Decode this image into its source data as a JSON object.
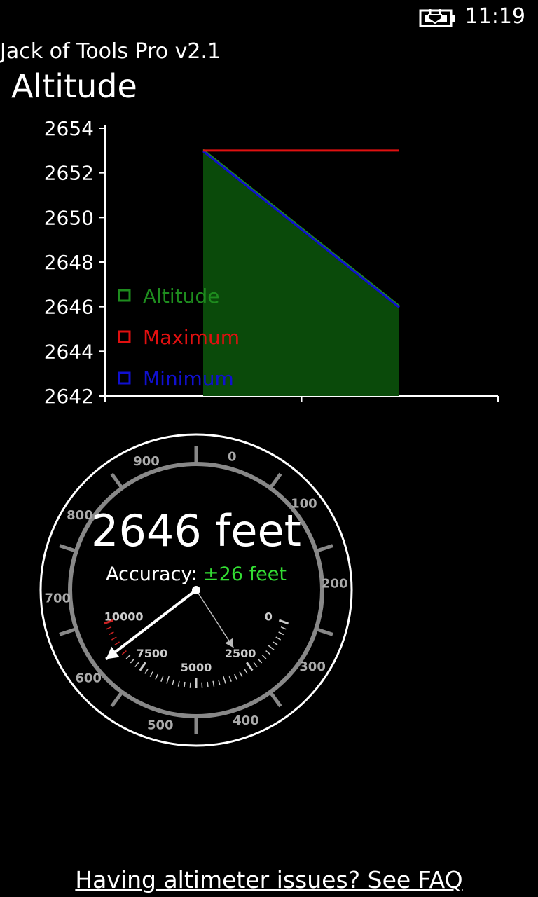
{
  "status_bar": {
    "time": "11:19",
    "battery_icon": "battery-charging-icon"
  },
  "app": {
    "title": "Jack of Tools Pro v2.1",
    "page_title": "Altitude"
  },
  "colors": {
    "altitude_fill": "#0A4A0A",
    "altitude": "#1E8C1E",
    "maximum": "#E01010",
    "minimum": "#1010D0",
    "accuracy_value": "#33DD33",
    "gauge_ring": "#888888",
    "redzone": "#CC2222"
  },
  "chart_data": {
    "type": "area",
    "ylim": [
      2642,
      2654
    ],
    "yticks": [
      "2642",
      "2644",
      "2646",
      "2648",
      "2650",
      "2652",
      "2654"
    ],
    "grid": false,
    "legend_position": "left",
    "series": [
      {
        "name": "Altitude",
        "values": [
          2653,
          2646
        ]
      },
      {
        "name": "Maximum",
        "values": [
          2653,
          2653
        ]
      },
      {
        "name": "Minimum",
        "values": [
          2653,
          2646
        ]
      }
    ]
  },
  "gauge": {
    "reading_value": "2646",
    "reading_unit": "feet",
    "accuracy_label": "Accuracy:",
    "accuracy_value": "±26 feet",
    "outer_labels": [
      "0",
      "100",
      "200",
      "300",
      "400",
      "500",
      "600",
      "700",
      "800",
      "900"
    ],
    "inner_labels": [
      "0",
      "2500",
      "5000",
      "7500",
      "10000"
    ],
    "long_hand_value": 646,
    "short_hand_value": 2646,
    "outer_max": 1000,
    "inner_max": 10000
  },
  "footer": {
    "faq_link": "Having altimeter issues? See FAQ"
  }
}
